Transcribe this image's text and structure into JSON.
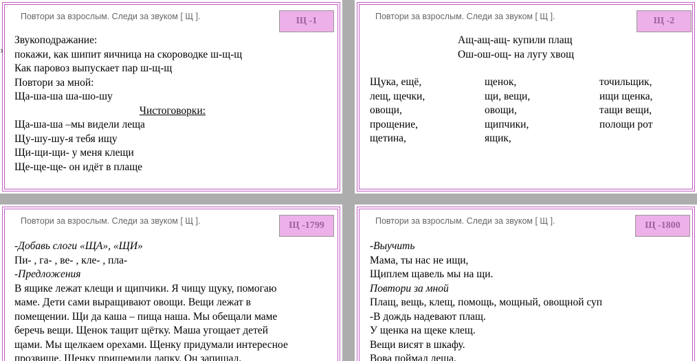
{
  "header_text": "Повтори за взрослым.  Следи за звуком [ Щ ].",
  "cards": [
    {
      "badge": "Щ -1",
      "lines": [
        "Звукоподражание:",
        "покажи, как шипит яичница на скороводке ш-щ-щ",
        "Как паровоз выпускает пар ш-щ-щ",
        "Повтори за мной:",
        "Ща-ша-ша ша-шо-шу",
        "Чистоговорки:",
        "Ща-ша-ша –мы видели леща",
        "Щу-шу-шу-я тебя ищу",
        "Щи-щи-щи- у меня клещи",
        "Ще-ще-ще- он идёт в плаще"
      ]
    },
    {
      "badge": "Щ -2",
      "rhyme": [
        "Ащ-ащ-ащ-  купили плащ",
        "Ош-ош-ощ-  на лугу хвощ"
      ],
      "col1": [
        "Щука, ещё,",
        "лещ, щечки,",
        "овощи,",
        "прощение,",
        "щетина,"
      ],
      "col2": [
        "щенок,",
        "щи, вещи,",
        "овощи,",
        "щипчики,",
        "ящик,"
      ],
      "col3": [
        "точильщик,",
        "ищи щенка,",
        "тащи вещи,",
        "полощи рот"
      ]
    },
    {
      "badge": "Щ -1799",
      "lines": [
        "-Добавь слоги «ЩА», «ЩИ»",
        "Пи-     , га- , ве-    , кле-    , пла-",
        "-Предложения",
        "В ящике лежат клещи и щипчики. Я чищу щуку, помогаю",
        "маме. Дети сами выращивают овощи. Вещи лежат в",
        "помещении. Щи да каша – пища наша. Мы обещали маме",
        "беречь вещи. Щенок тащит щётку. Маша угощает детей",
        "щами. Мы щелкаем орехами. Щенку придумали интересное",
        "прозвище. Щенку прищемили лапку. Он запищал."
      ]
    },
    {
      "badge": "Щ -1800",
      "lines": [
        "-Выучить",
        "Мама, ты нас не ищи,",
        "Щиплем щавель мы на щи.",
        "Повтори за мной",
        "Плащ, вещь, клещ, помощь, мощный, овощной суп",
        "-В дождь надевают плащ.",
        "У щенка на щеке клещ.",
        "Вещи висят в шкафу.",
        "Вова поймал леща."
      ]
    }
  ],
  "cursor": "›"
}
